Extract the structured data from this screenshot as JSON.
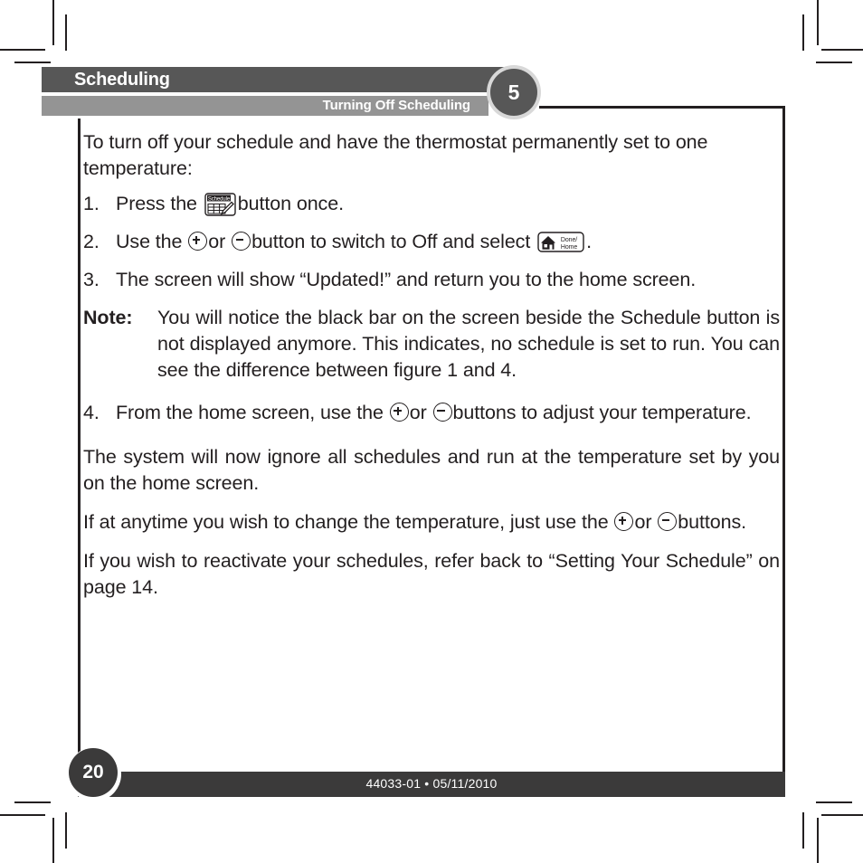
{
  "header": {
    "chapter_title": "Scheduling",
    "section_title": "Turning Off Scheduling",
    "chapter_number": "5"
  },
  "content": {
    "intro": "To turn off your schedule and have the thermostat permanently set to one temperature:",
    "steps": [
      {
        "number": "1.",
        "text_before": "Press the",
        "icon": "schedule-button-icon",
        "text_after": "button once."
      },
      {
        "number": "2.",
        "text_before": "Use the",
        "icon_plus": "plus-button-icon",
        "text_or": "or",
        "icon_minus": "minus-button-icon",
        "text_mid": "button to switch to Off and select",
        "icon_home": "done-home-button-icon",
        "text_after": "."
      },
      {
        "number": "3.",
        "text": "The screen will show “Updated!” and return you to the home screen."
      },
      {
        "number": "4.",
        "text_before": "From the home screen, use the",
        "icon_plus": "plus-button-icon",
        "text_or": "or",
        "icon_minus": "minus-button-icon",
        "text_after": "buttons to adjust your temperature."
      }
    ],
    "note": {
      "label": "Note:",
      "text": "You will notice the black bar on the screen beside the Schedule button is not displayed anymore. This indicates, no schedule is set to run. You can see the difference between figure 1 and 4."
    },
    "paragraph_system": "The system will now ignore all schedules and run at the temperature set by you on the home screen.",
    "paragraph_anytime_before": "If at anytime you wish to change the temperature, just use the",
    "paragraph_anytime_or": "or",
    "paragraph_anytime_after": "buttons.",
    "paragraph_reactivate": "If you wish to reactivate your schedules, refer back to “Setting Your Schedule” on page 14."
  },
  "icons": {
    "schedule_label": "Schedule",
    "home_label_line1": "Done/",
    "home_label_line2": "Home"
  },
  "footer": {
    "document_id": "44033-01  •  05/11/2010",
    "page_number": "20"
  },
  "colors": {
    "header_dark": "#575757",
    "header_light": "#949494",
    "footer_dark": "#3b3a3a",
    "ink": "#231f20"
  }
}
